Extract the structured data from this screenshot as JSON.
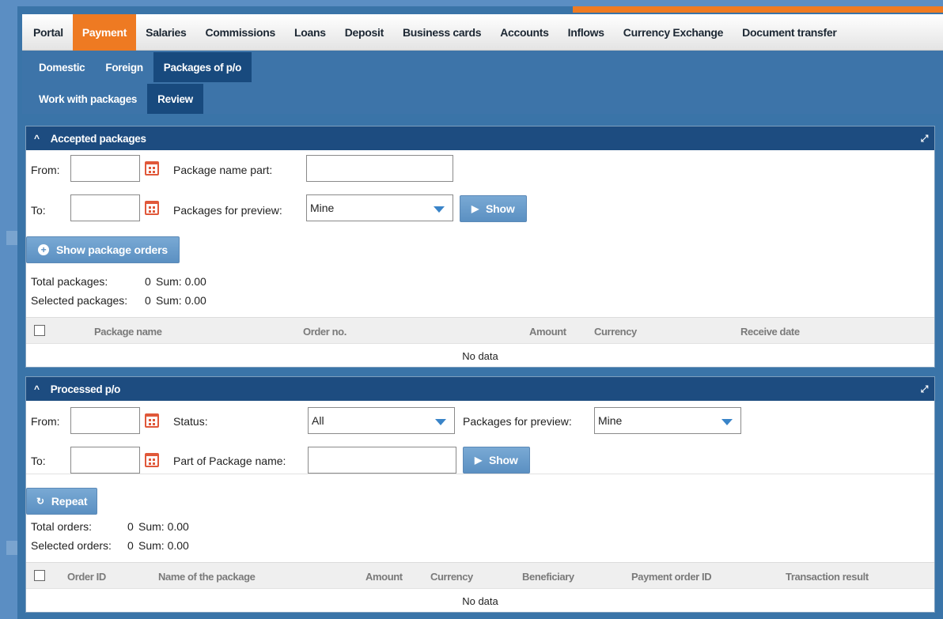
{
  "topnav": {
    "items": [
      "Portal",
      "Payment",
      "Salaries",
      "Commissions",
      "Loans",
      "Deposit",
      "Business cards",
      "Accounts",
      "Inflows",
      "Currency Exchange",
      "Document transfer"
    ],
    "active": "Payment"
  },
  "subnav": {
    "row1": [
      "Domestic",
      "Foreign",
      "Packages of p/o"
    ],
    "row2": [
      "Work with packages",
      "Review"
    ]
  },
  "accepted": {
    "title": "Accepted packages",
    "from_label": "From:",
    "to_label": "To:",
    "name_part_label": "Package name part:",
    "preview_label": "Packages for preview:",
    "preview_value": "Mine",
    "show_label": "Show",
    "show_orders_label": "Show package orders",
    "total_label": "Total packages:",
    "total_value": "0",
    "total_sum": "Sum: 0.00",
    "selected_label": "Selected packages:",
    "selected_value": "0",
    "selected_sum": "Sum: 0.00",
    "columns": [
      "Package name",
      "Order no.",
      "Amount",
      "Currency",
      "Receive date"
    ],
    "no_data": "No data"
  },
  "processed": {
    "title": "Processed p/o",
    "from_label": "From:",
    "to_label": "To:",
    "status_label": "Status:",
    "status_value": "All",
    "preview_label": "Packages for preview:",
    "preview_value": "Mine",
    "name_part_label": "Part of Package name:",
    "show_label": "Show",
    "repeat_label": "Repeat",
    "total_label": "Total orders:",
    "total_value": "0",
    "total_sum": "Sum: 0.00",
    "selected_label": "Selected orders:",
    "selected_value": "0",
    "selected_sum": "Sum: 0.00",
    "columns": [
      "Order ID",
      "Name of the package",
      "Amount",
      "Currency",
      "Beneficiary",
      "Payment order ID",
      "Transaction result"
    ],
    "no_data": "No data"
  },
  "colors": {
    "accent_orange": "#ee7a22",
    "header_blue": "#1d4c80",
    "subnav_blue": "#3d74a9",
    "button_blue": "#5b90c2",
    "calendar_red": "#e0583a"
  },
  "icons": [
    "caret-up-icon",
    "expand-icon",
    "calendar-icon",
    "dropdown-arrow-icon",
    "play-icon",
    "plus-circle-icon",
    "repeat-icon",
    "checkbox-icon"
  ]
}
